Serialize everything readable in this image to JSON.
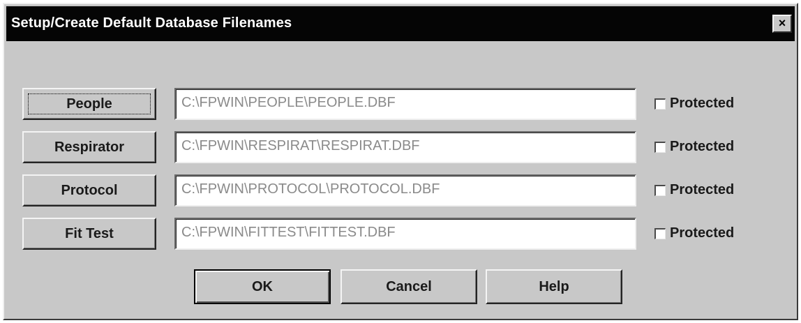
{
  "window": {
    "title": "Setup/Create Default Database Filenames",
    "close_label": "×"
  },
  "rows": [
    {
      "button_label": "People",
      "path": "C:\\FPWIN\\PEOPLE\\PEOPLE.DBF",
      "checkbox_label": "Protected",
      "protected": false
    },
    {
      "button_label": "Respirator",
      "path": "C:\\FPWIN\\RESPIRAT\\RESPIRAT.DBF",
      "checkbox_label": "Protected",
      "protected": false
    },
    {
      "button_label": "Protocol",
      "path": "C:\\FPWIN\\PROTOCOL\\PROTOCOL.DBF",
      "checkbox_label": "Protected",
      "protected": false
    },
    {
      "button_label": "Fit Test",
      "path": "C:\\FPWIN\\FITTEST\\FITTEST.DBF",
      "checkbox_label": "Protected",
      "protected": false
    }
  ],
  "footer": {
    "ok_label": "OK",
    "cancel_label": "Cancel",
    "help_label": "Help"
  }
}
